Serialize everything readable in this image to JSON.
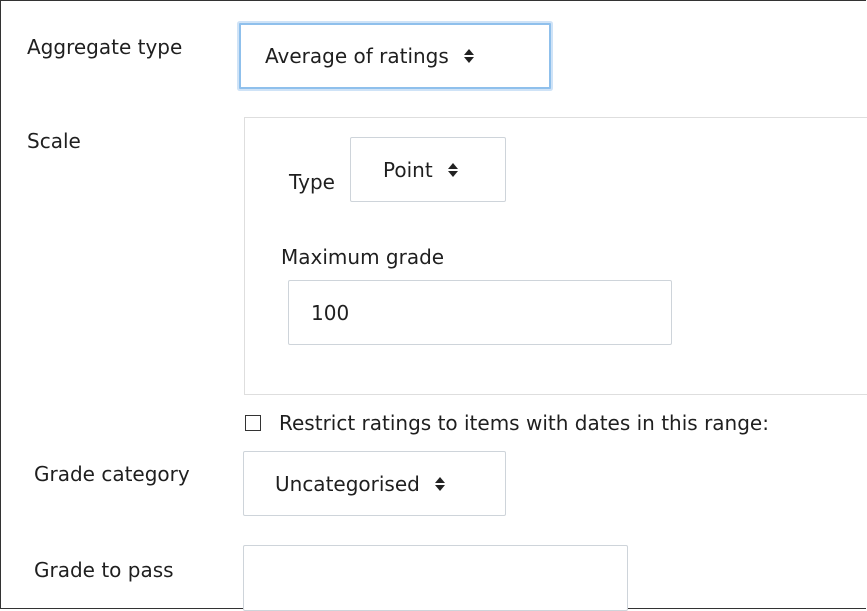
{
  "aggregate": {
    "label": "Aggregate type",
    "selected": "Average of ratings"
  },
  "scale": {
    "label": "Scale",
    "type_label": "Type",
    "type_selected": "Point",
    "max_grade_label": "Maximum grade",
    "max_grade_value": "100"
  },
  "restrict": {
    "label": "Restrict ratings to items with dates in this range:",
    "checked": false
  },
  "grade_category": {
    "label": "Grade category",
    "selected": "Uncategorised"
  },
  "grade_to_pass": {
    "label": "Grade to pass",
    "value": ""
  },
  "icons": {
    "select_caret": "up-down-caret-icon",
    "checkbox": "checkbox-icon"
  },
  "colors": {
    "focus_border": "#8fc0ec",
    "input_border": "#ced4da",
    "text": "#1f1f1f"
  }
}
